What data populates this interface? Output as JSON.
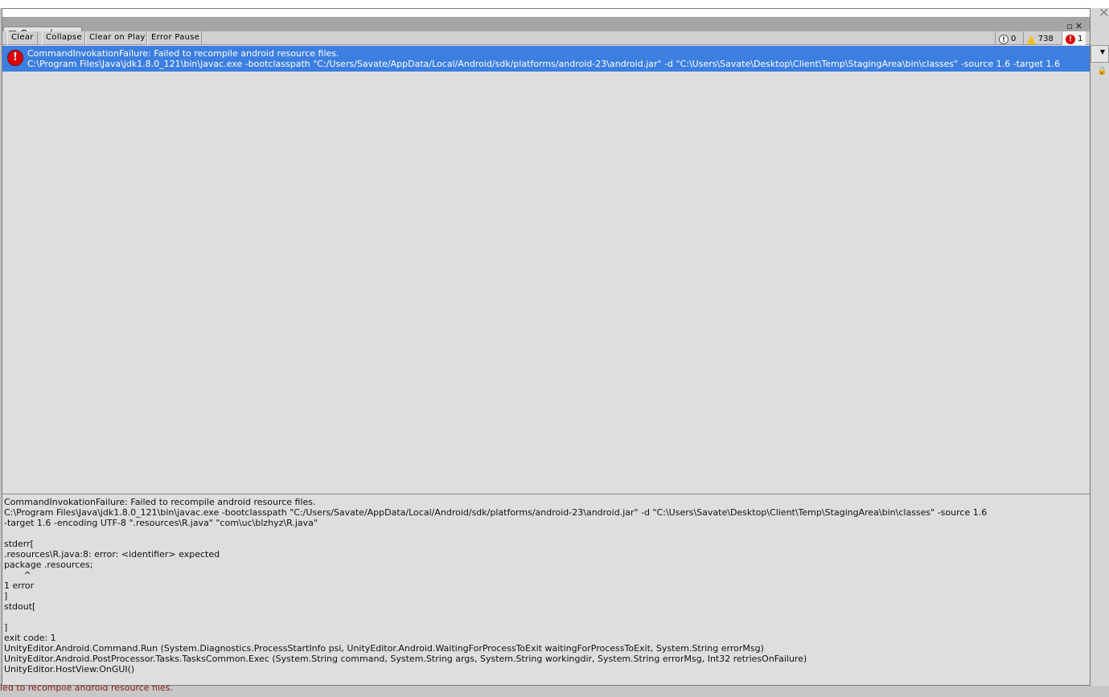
{
  "window": {
    "tab_title": "Console"
  },
  "toolbar": {
    "clear": "Clear",
    "collapse": "Collapse",
    "clear_on_play": "Clear on Play",
    "error_pause": "Error Pause"
  },
  "counts": {
    "info": "0",
    "warning": "738",
    "error": "1"
  },
  "colors": {
    "selection": "#3d7fe0",
    "error": "#dd0000",
    "warning": "#f2c200"
  },
  "log": [
    {
      "line1": "CommandInvokationFailure: Failed to recompile android resource files.",
      "line2": "C:\\Program Files\\Java\\jdk1.8.0_121\\bin\\javac.exe -bootclasspath \"C:/Users/Savate/AppData/Local/Android/sdk/platforms/android-23\\android.jar\" -d \"C:\\Users\\Savate\\Desktop\\Client\\Temp\\StagingArea\\bin\\classes\" -source 1.6 -target 1.6"
    }
  ],
  "detail": "CommandInvokationFailure: Failed to recompile android resource files.\nC:\\Program Files\\Java\\jdk1.8.0_121\\bin\\javac.exe -bootclasspath \"C:/Users/Savate/AppData/Local/Android/sdk/platforms/android-23\\android.jar\" -d \"C:\\Users\\Savate\\Desktop\\Client\\Temp\\StagingArea\\bin\\classes\" -source 1.6\n-target 1.6 -encoding UTF-8 \".resources\\R.java\" \"com\\uc\\blzhyz\\R.java\"\n\nstderr[\n.resources\\R.java:8: error: <identifier> expected\npackage .resources;\n       ^\n1 error\n]\nstdout[\n\n]\nexit code: 1\nUnityEditor.Android.Command.Run (System.Diagnostics.ProcessStartInfo psi, UnityEditor.Android.WaitingForProcessToExit waitingForProcessToExit, System.String errorMsg)\nUnityEditor.Android.PostProcessor.Tasks.TasksCommon.Exec (System.String command, System.String args, System.String workingdir, System.String errorMsg, Int32 retriesOnFailure)\nUnityEditor.HostView:OnGUI()",
  "status_bar": "led to recompile android resource files."
}
